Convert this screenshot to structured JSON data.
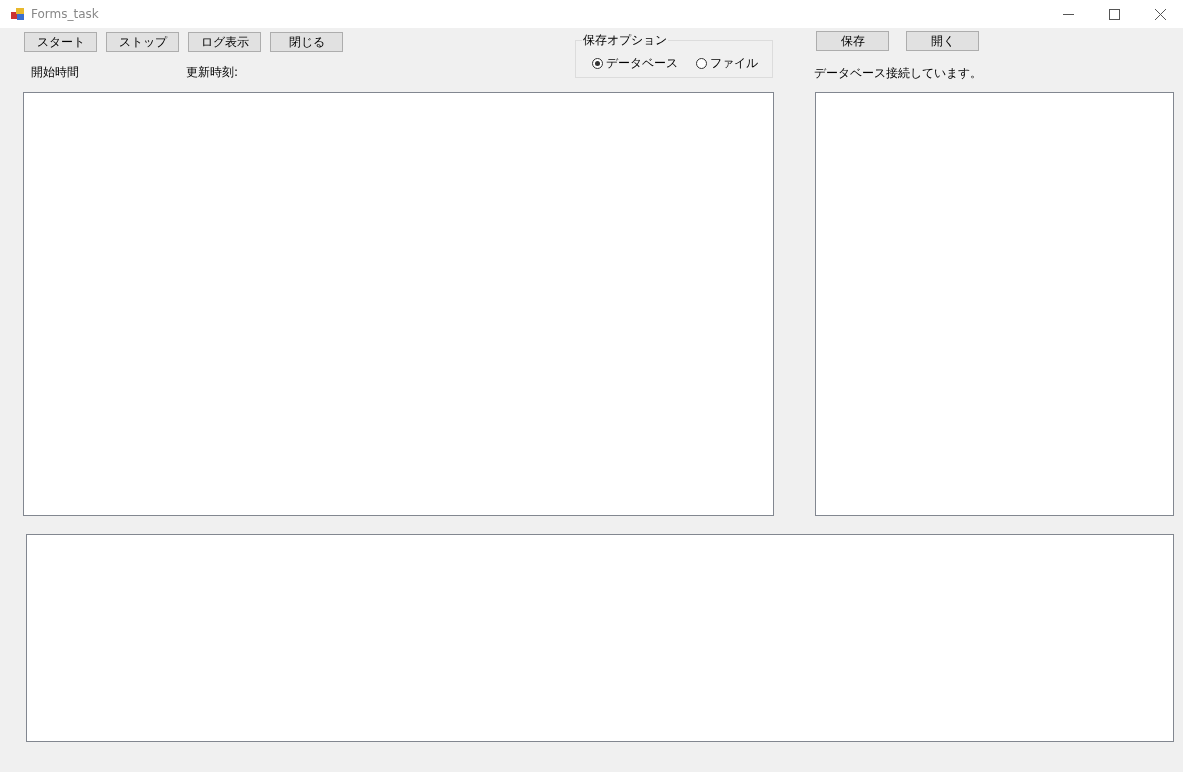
{
  "window": {
    "title": "Forms_task"
  },
  "toolbar_buttons": [
    "スタート",
    "ストップ",
    "ログ表示",
    "閉じる"
  ],
  "labels": {
    "start_time": "開始時間",
    "update_time": "更新時刻:"
  },
  "save_option": {
    "title": "保存オプション",
    "options": [
      {
        "label": "データベース",
        "selected": true
      },
      {
        "label": "ファイル",
        "selected": false
      }
    ]
  },
  "file_buttons": [
    "保存",
    "開く"
  ],
  "status": "データベース接続しています。"
}
